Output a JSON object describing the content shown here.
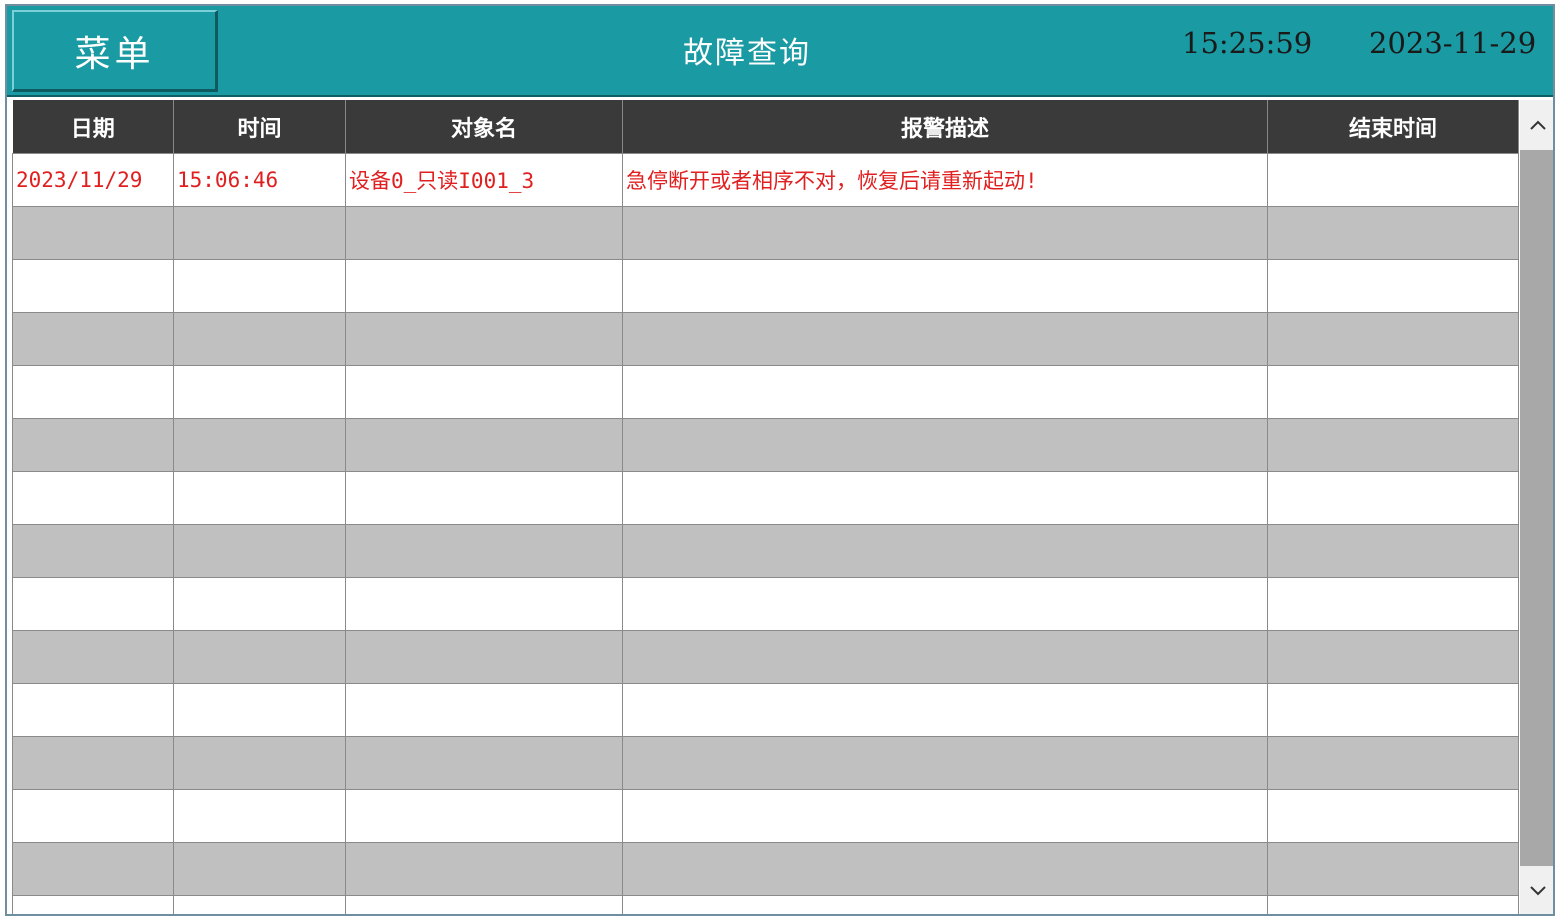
{
  "header": {
    "menu_label": "菜单",
    "title": "故障查询",
    "time": "15:25:59",
    "date": "2023-11-29"
  },
  "table": {
    "columns": [
      "日期",
      "时间",
      "对象名",
      "报警描述",
      "结束时间"
    ],
    "rows": [
      [
        "2023/11/29",
        "15:06:46",
        "设备0_只读I001_3",
        "急停断开或者相序不对，恢复后请重新起动!",
        ""
      ],
      [
        "",
        "",
        "",
        "",
        ""
      ],
      [
        "",
        "",
        "",
        "",
        ""
      ],
      [
        "",
        "",
        "",
        "",
        ""
      ],
      [
        "",
        "",
        "",
        "",
        ""
      ],
      [
        "",
        "",
        "",
        "",
        ""
      ],
      [
        "",
        "",
        "",
        "",
        ""
      ],
      [
        "",
        "",
        "",
        "",
        ""
      ],
      [
        "",
        "",
        "",
        "",
        ""
      ],
      [
        "",
        "",
        "",
        "",
        ""
      ],
      [
        "",
        "",
        "",
        "",
        ""
      ],
      [
        "",
        "",
        "",
        "",
        ""
      ],
      [
        "",
        "",
        "",
        "",
        ""
      ],
      [
        "",
        "",
        "",
        "",
        ""
      ],
      [
        "",
        "",
        "",
        "",
        ""
      ]
    ]
  },
  "icons": {
    "scroll_up": "chevron-up-icon",
    "scroll_down": "chevron-down-icon"
  },
  "colors": {
    "header_bg": "#1a9aa3",
    "table_header_bg": "#3a3a3a",
    "alarm_text": "#e02020",
    "row_alt": "#c0c0c0"
  }
}
